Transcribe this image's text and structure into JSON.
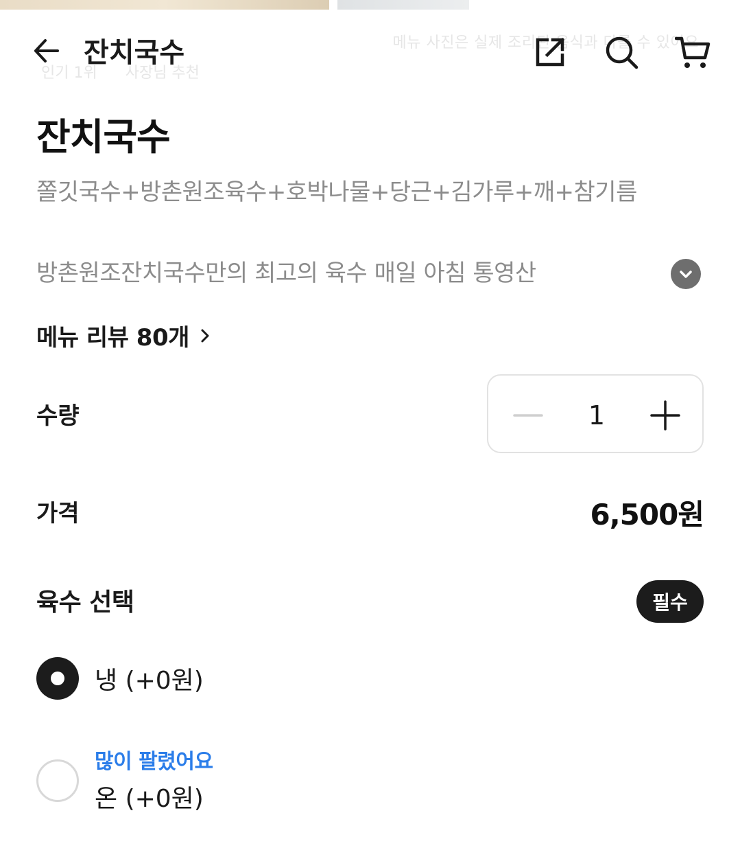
{
  "header": {
    "title": "잔치국수",
    "photo_caption": "메뉴 사진은 실제 조리된 음식과 다를 수 있어요",
    "photo_tags": [
      "인기 1위",
      "사장님 추천"
    ],
    "icons": [
      "back-arrow-icon",
      "share-icon",
      "search-icon",
      "cart-icon"
    ]
  },
  "menu": {
    "title": "잔치국수",
    "description_line1": "쫄깃국수+방촌원조육수+호박나물+당근+김가루+깨+참기름",
    "description_line2": "방촌원조잔치국수만의 최고의 육수 매일 아침 통영산",
    "review_link": "메뉴 리뷰 80개"
  },
  "quantity": {
    "label": "수량",
    "value": "1"
  },
  "price": {
    "label": "가격",
    "value": "6,500원"
  },
  "option_group": {
    "title": "육수 선택",
    "required_badge": "필수",
    "options": [
      {
        "label": "냉 (+0원)",
        "selected": true,
        "badge": ""
      },
      {
        "label": "온 (+0원)",
        "selected": false,
        "badge": "많이 팔렸어요"
      }
    ]
  },
  "colors": {
    "text": "#1a1a1a",
    "muted": "#8c8c8c",
    "accent_blue": "#2b7de9",
    "badge_bg": "#1c1c1c",
    "border": "#e2e2e2"
  }
}
